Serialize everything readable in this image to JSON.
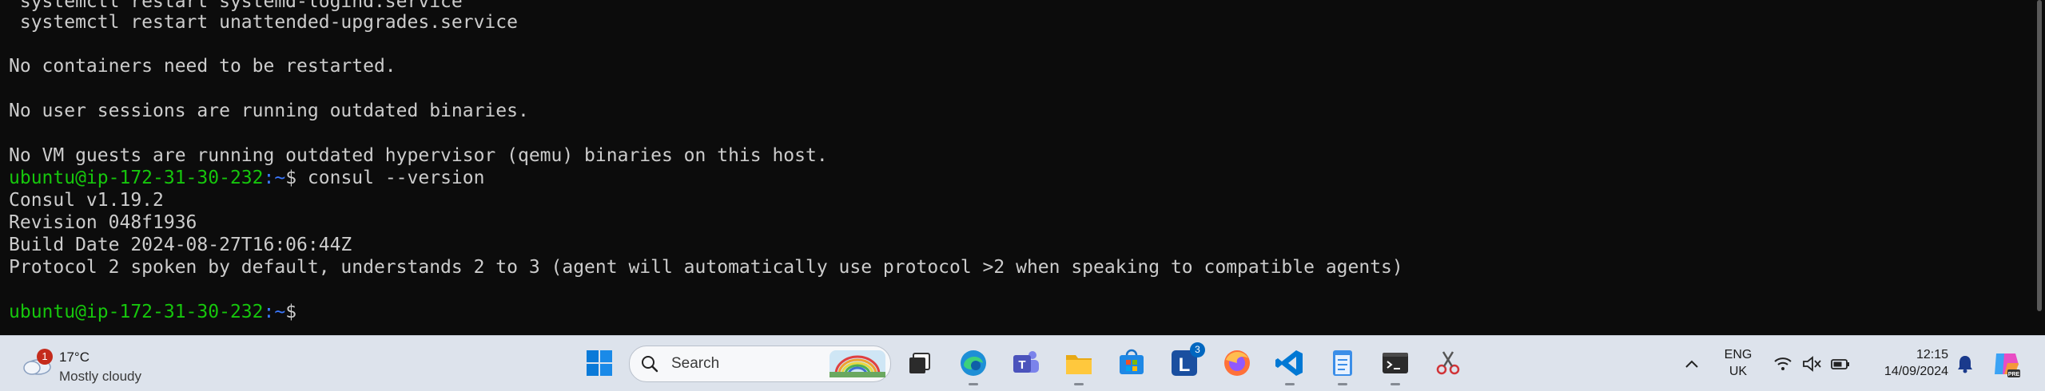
{
  "terminal": {
    "lines": [
      {
        "text": " systemctl restart systemd-logind.service"
      },
      {
        "text": " systemctl restart unattended-upgrades.service"
      },
      {
        "text": ""
      },
      {
        "text": "No containers need to be restarted."
      },
      {
        "text": ""
      },
      {
        "text": "No user sessions are running outdated binaries."
      },
      {
        "text": ""
      },
      {
        "text": "No VM guests are running outdated hypervisor (qemu) binaries on this host."
      },
      {
        "prompt_user": "ubuntu@ip-172-31-30-232",
        "prompt_path": ":~",
        "text": "$ consul --version"
      },
      {
        "text": "Consul v1.19.2"
      },
      {
        "text": "Revision 048f1936"
      },
      {
        "text": "Build Date 2024-08-27T16:06:44Z"
      },
      {
        "text": "Protocol 2 spoken by default, understands 2 to 3 (agent will automatically use protocol >2 when speaking to compatible agents)"
      },
      {
        "text": ""
      },
      {
        "prompt_user": "ubuntu@ip-172-31-30-232",
        "prompt_path": ":~",
        "text": "$ "
      }
    ]
  },
  "taskbar": {
    "weather": {
      "badge": "1",
      "temperature": "17°C",
      "description": "Mostly cloudy",
      "icon": "cloud-icon"
    },
    "search": {
      "label": "Search"
    },
    "apps": [
      {
        "name": "task-view-icon"
      },
      {
        "name": "edge-icon"
      },
      {
        "name": "teams-icon"
      },
      {
        "name": "file-explorer-icon"
      },
      {
        "name": "microsoft-store-icon"
      },
      {
        "name": "lens-icon",
        "badge": "3"
      },
      {
        "name": "firefox-icon"
      },
      {
        "name": "vscode-icon"
      },
      {
        "name": "notepad-icon"
      },
      {
        "name": "terminal-icon"
      },
      {
        "name": "snipping-tool-icon"
      }
    ],
    "tray": {
      "language_line1": "ENG",
      "language_line2": "UK",
      "time": "12:15",
      "date": "14/09/2024"
    }
  },
  "colors": {
    "terminal_bg": "#0c0c0c",
    "terminal_text": "#cccccc",
    "prompt_user": "#16c60c",
    "prompt_path": "#3b78ff",
    "taskbar_bg": "#dde3ec"
  }
}
